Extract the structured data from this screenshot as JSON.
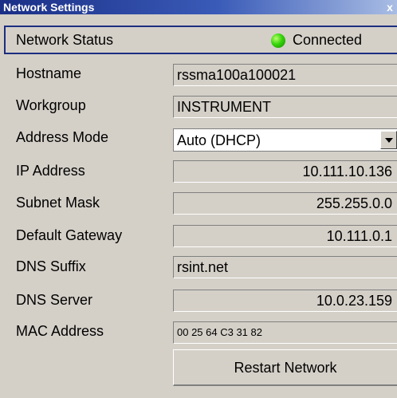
{
  "window": {
    "title": "Network Settings",
    "close_glyph": "x"
  },
  "status": {
    "label": "Network Status",
    "value": "Connected",
    "led_color": "#35d40a"
  },
  "fields": {
    "hostname": {
      "label": "Hostname",
      "value": "rssma100a100021"
    },
    "workgroup": {
      "label": "Workgroup",
      "value": "INSTRUMENT"
    },
    "address_mode": {
      "label": "Address Mode",
      "value": "Auto (DHCP)"
    },
    "ip_address": {
      "label": "IP Address",
      "value": "10.111.10.136"
    },
    "subnet_mask": {
      "label": "Subnet Mask",
      "value": "255.255.0.0"
    },
    "default_gateway": {
      "label": "Default Gateway",
      "value": "10.111.0.1"
    },
    "dns_suffix": {
      "label": "DNS Suffix",
      "value": "rsint.net"
    },
    "dns_server": {
      "label": "DNS Server",
      "value": "10.0.23.159"
    },
    "mac_address": {
      "label": "MAC Address",
      "value": "00 25 64 C3 31 82"
    }
  },
  "actions": {
    "restart_label": "Restart Network"
  }
}
